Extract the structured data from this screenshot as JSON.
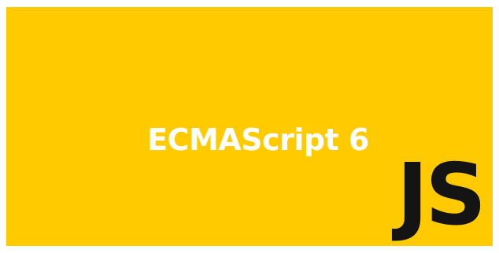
{
  "banner": {
    "title": "ECMAScript 6",
    "logo_text": "JS",
    "background_color": "#FFCB00",
    "title_color": "#FFFFFF",
    "logo_color": "#141414"
  }
}
